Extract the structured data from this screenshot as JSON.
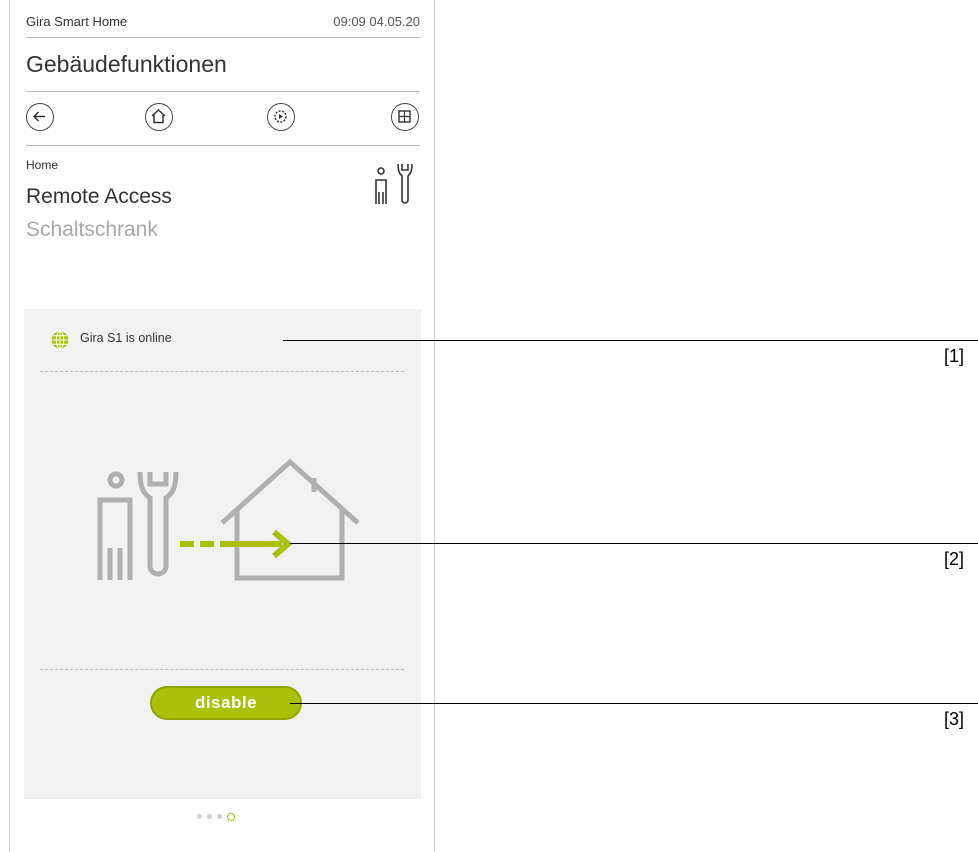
{
  "status_bar": {
    "app_name": "Gira Smart Home",
    "datetime": "09:09 04.05.20"
  },
  "page_title": "Gebäudefunktionen",
  "nav": {
    "back_icon": "arrow-left-icon",
    "home_icon": "home-icon",
    "scenes_icon": "gear-play-icon",
    "grid_icon": "grid-icon"
  },
  "breadcrumb": "Home",
  "heading": "Remote Access",
  "subheading": "Schaltschrank",
  "card": {
    "status_icon": "globe-icon",
    "status_text": "Gira S1 is online",
    "illustration": "technician-to-house-icon",
    "button_label": "disable"
  },
  "pagination": {
    "total": 4,
    "active": 4
  },
  "callouts": [
    "[1]",
    "[2]",
    "[3]"
  ],
  "colors": {
    "accent": "#aac10a",
    "card_bg": "#f2f2f2",
    "icon_gray": "#b0b0b0"
  }
}
